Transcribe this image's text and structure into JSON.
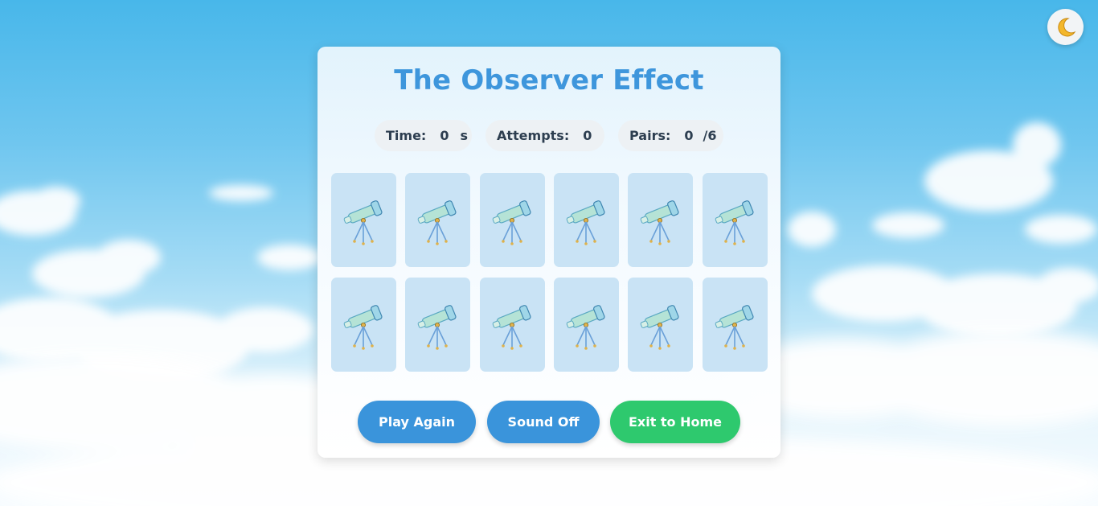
{
  "header": {
    "theme_toggle_icon": "crescent-moon-icon",
    "theme_toggle_glyph": "🌙"
  },
  "game": {
    "title": "The Observer Effect",
    "stats": {
      "time_label": "Time:",
      "time_value": "0",
      "time_unit": "s",
      "attempts_label": "Attempts:",
      "attempts_value": "0",
      "pairs_label": "Pairs:",
      "pairs_value": "0",
      "pairs_total": "/6"
    },
    "card_back_icon": "telescope-icon",
    "cards": [
      {
        "state": "face-down"
      },
      {
        "state": "face-down"
      },
      {
        "state": "face-down"
      },
      {
        "state": "face-down"
      },
      {
        "state": "face-down"
      },
      {
        "state": "face-down"
      },
      {
        "state": "face-down"
      },
      {
        "state": "face-down"
      },
      {
        "state": "face-down"
      },
      {
        "state": "face-down"
      },
      {
        "state": "face-down"
      },
      {
        "state": "face-down"
      }
    ],
    "buttons": {
      "play_again": "Play Again",
      "sound": "Sound Off",
      "exit": "Exit to Home"
    }
  },
  "colors": {
    "title": "#3e96dc",
    "primary_button": "#3a94db",
    "exit_button": "#2ec96e",
    "card_back": "#c9e3f5"
  }
}
